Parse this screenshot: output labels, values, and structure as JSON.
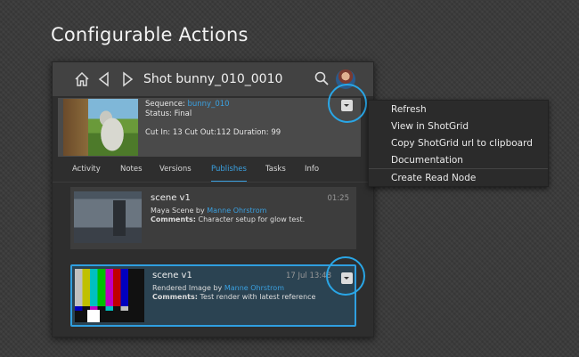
{
  "headline": "Configurable Actions",
  "topbar": {
    "icons": [
      "home-icon",
      "back-icon",
      "forward-icon",
      "search-icon"
    ],
    "title": "Shot bunny_010_0010"
  },
  "info": {
    "sequence_label": "Sequence:",
    "sequence_value": "bunny_010",
    "status_label": "Status:",
    "status_value": "Final",
    "cut_line": "Cut In: 13 Cut Out:112 Duration: 99"
  },
  "tabs": [
    {
      "label": "Activity"
    },
    {
      "label": "Notes"
    },
    {
      "label": "Versions"
    },
    {
      "label": "Publishes",
      "active": true
    },
    {
      "label": "Tasks"
    },
    {
      "label": "Info"
    }
  ],
  "publishes": [
    {
      "title": "scene v1",
      "time": "01:25",
      "type": "Maya Scene by",
      "author": "Manne Ohrstrom",
      "comments_label": "Comments:",
      "comments": "Character setup for glow test."
    },
    {
      "title": "scene v1",
      "time": "17 Jul 13:48",
      "type": "Rendered Image by",
      "author": "Manne Ohrstrom",
      "comments_label": "Comments:",
      "comments": "Test render with latest reference"
    }
  ],
  "menu": {
    "items": [
      "Refresh",
      "View in ShotGrid",
      "Copy ShotGrid url to clipboard",
      "Documentation"
    ],
    "separated_item": "Create Read Node"
  },
  "colors": {
    "accent": "#2f9fe0",
    "link": "#3aa0e0"
  }
}
